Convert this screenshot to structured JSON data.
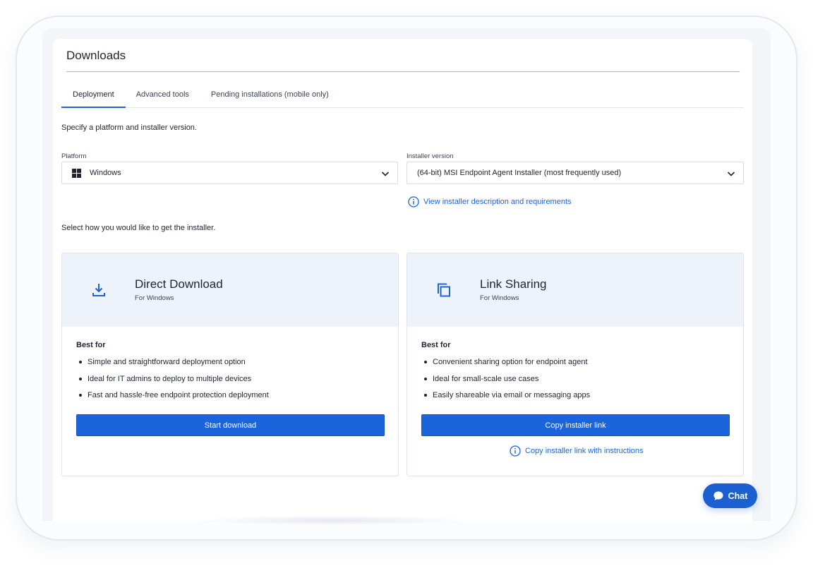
{
  "page": {
    "title": "Downloads"
  },
  "tabs": [
    {
      "label": "Deployment",
      "active": true
    },
    {
      "label": "Advanced tools",
      "active": false
    },
    {
      "label": "Pending installations (mobile only)",
      "active": false
    }
  ],
  "instructions": {
    "platform_prompt": "Specify a platform and installer version.",
    "method_prompt": "Select how you would like to get the installer."
  },
  "platform": {
    "label": "Platform",
    "value": "Windows",
    "icon": "windows-icon"
  },
  "installer": {
    "label": "Installer version",
    "value": "(64-bit) MSI Endpoint Agent Installer (most frequently used)",
    "info_link": "View installer description and requirements"
  },
  "cards": {
    "direct": {
      "title": "Direct Download",
      "subtitle": "For Windows",
      "icon": "download-icon",
      "best_for": "Best for",
      "bullets": [
        "Simple and straightforward deployment option",
        "Ideal for IT admins to deploy to multiple devices",
        "Fast and hassle-free endpoint protection deployment"
      ],
      "button": "Start download"
    },
    "link": {
      "title": "Link Sharing",
      "subtitle": "For Windows",
      "icon": "copy-icon",
      "best_for": "Best for",
      "bullets": [
        "Convenient sharing option for endpoint agent",
        "Ideal for small-scale use cases",
        "Easily shareable via email or messaging apps"
      ],
      "button": "Copy installer link",
      "secondary_link": "Copy installer link with instructions"
    }
  },
  "chat": {
    "label": "Chat"
  },
  "colors": {
    "accent": "#1b64dc",
    "card_header": "#eef2fa"
  }
}
